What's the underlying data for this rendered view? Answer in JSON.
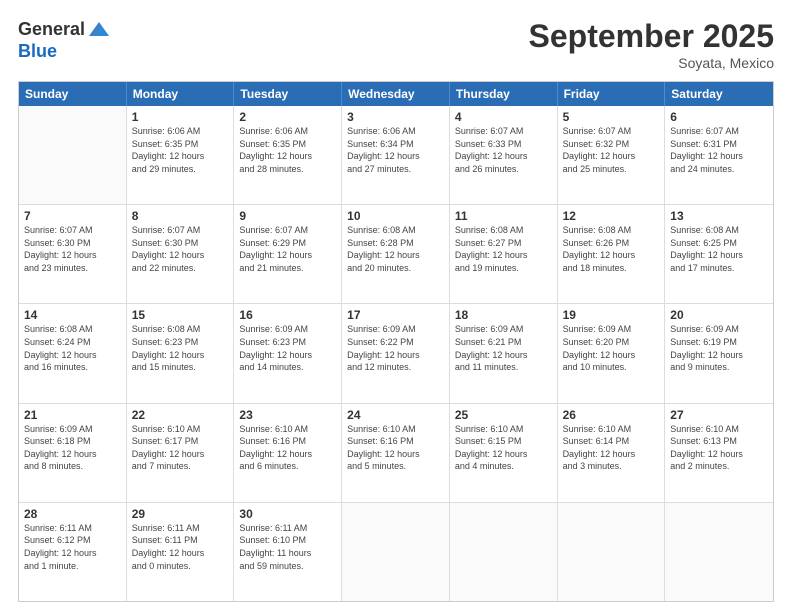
{
  "header": {
    "logo_line1": "General",
    "logo_line2": "Blue",
    "month": "September 2025",
    "location": "Soyata, Mexico"
  },
  "weekdays": [
    "Sunday",
    "Monday",
    "Tuesday",
    "Wednesday",
    "Thursday",
    "Friday",
    "Saturday"
  ],
  "rows": [
    [
      {
        "day": "",
        "info": ""
      },
      {
        "day": "1",
        "info": "Sunrise: 6:06 AM\nSunset: 6:35 PM\nDaylight: 12 hours\nand 29 minutes."
      },
      {
        "day": "2",
        "info": "Sunrise: 6:06 AM\nSunset: 6:35 PM\nDaylight: 12 hours\nand 28 minutes."
      },
      {
        "day": "3",
        "info": "Sunrise: 6:06 AM\nSunset: 6:34 PM\nDaylight: 12 hours\nand 27 minutes."
      },
      {
        "day": "4",
        "info": "Sunrise: 6:07 AM\nSunset: 6:33 PM\nDaylight: 12 hours\nand 26 minutes."
      },
      {
        "day": "5",
        "info": "Sunrise: 6:07 AM\nSunset: 6:32 PM\nDaylight: 12 hours\nand 25 minutes."
      },
      {
        "day": "6",
        "info": "Sunrise: 6:07 AM\nSunset: 6:31 PM\nDaylight: 12 hours\nand 24 minutes."
      }
    ],
    [
      {
        "day": "7",
        "info": "Sunrise: 6:07 AM\nSunset: 6:30 PM\nDaylight: 12 hours\nand 23 minutes."
      },
      {
        "day": "8",
        "info": "Sunrise: 6:07 AM\nSunset: 6:30 PM\nDaylight: 12 hours\nand 22 minutes."
      },
      {
        "day": "9",
        "info": "Sunrise: 6:07 AM\nSunset: 6:29 PM\nDaylight: 12 hours\nand 21 minutes."
      },
      {
        "day": "10",
        "info": "Sunrise: 6:08 AM\nSunset: 6:28 PM\nDaylight: 12 hours\nand 20 minutes."
      },
      {
        "day": "11",
        "info": "Sunrise: 6:08 AM\nSunset: 6:27 PM\nDaylight: 12 hours\nand 19 minutes."
      },
      {
        "day": "12",
        "info": "Sunrise: 6:08 AM\nSunset: 6:26 PM\nDaylight: 12 hours\nand 18 minutes."
      },
      {
        "day": "13",
        "info": "Sunrise: 6:08 AM\nSunset: 6:25 PM\nDaylight: 12 hours\nand 17 minutes."
      }
    ],
    [
      {
        "day": "14",
        "info": "Sunrise: 6:08 AM\nSunset: 6:24 PM\nDaylight: 12 hours\nand 16 minutes."
      },
      {
        "day": "15",
        "info": "Sunrise: 6:08 AM\nSunset: 6:23 PM\nDaylight: 12 hours\nand 15 minutes."
      },
      {
        "day": "16",
        "info": "Sunrise: 6:09 AM\nSunset: 6:23 PM\nDaylight: 12 hours\nand 14 minutes."
      },
      {
        "day": "17",
        "info": "Sunrise: 6:09 AM\nSunset: 6:22 PM\nDaylight: 12 hours\nand 12 minutes."
      },
      {
        "day": "18",
        "info": "Sunrise: 6:09 AM\nSunset: 6:21 PM\nDaylight: 12 hours\nand 11 minutes."
      },
      {
        "day": "19",
        "info": "Sunrise: 6:09 AM\nSunset: 6:20 PM\nDaylight: 12 hours\nand 10 minutes."
      },
      {
        "day": "20",
        "info": "Sunrise: 6:09 AM\nSunset: 6:19 PM\nDaylight: 12 hours\nand 9 minutes."
      }
    ],
    [
      {
        "day": "21",
        "info": "Sunrise: 6:09 AM\nSunset: 6:18 PM\nDaylight: 12 hours\nand 8 minutes."
      },
      {
        "day": "22",
        "info": "Sunrise: 6:10 AM\nSunset: 6:17 PM\nDaylight: 12 hours\nand 7 minutes."
      },
      {
        "day": "23",
        "info": "Sunrise: 6:10 AM\nSunset: 6:16 PM\nDaylight: 12 hours\nand 6 minutes."
      },
      {
        "day": "24",
        "info": "Sunrise: 6:10 AM\nSunset: 6:16 PM\nDaylight: 12 hours\nand 5 minutes."
      },
      {
        "day": "25",
        "info": "Sunrise: 6:10 AM\nSunset: 6:15 PM\nDaylight: 12 hours\nand 4 minutes."
      },
      {
        "day": "26",
        "info": "Sunrise: 6:10 AM\nSunset: 6:14 PM\nDaylight: 12 hours\nand 3 minutes."
      },
      {
        "day": "27",
        "info": "Sunrise: 6:10 AM\nSunset: 6:13 PM\nDaylight: 12 hours\nand 2 minutes."
      }
    ],
    [
      {
        "day": "28",
        "info": "Sunrise: 6:11 AM\nSunset: 6:12 PM\nDaylight: 12 hours\nand 1 minute."
      },
      {
        "day": "29",
        "info": "Sunrise: 6:11 AM\nSunset: 6:11 PM\nDaylight: 12 hours\nand 0 minutes."
      },
      {
        "day": "30",
        "info": "Sunrise: 6:11 AM\nSunset: 6:10 PM\nDaylight: 11 hours\nand 59 minutes."
      },
      {
        "day": "",
        "info": ""
      },
      {
        "day": "",
        "info": ""
      },
      {
        "day": "",
        "info": ""
      },
      {
        "day": "",
        "info": ""
      }
    ]
  ]
}
